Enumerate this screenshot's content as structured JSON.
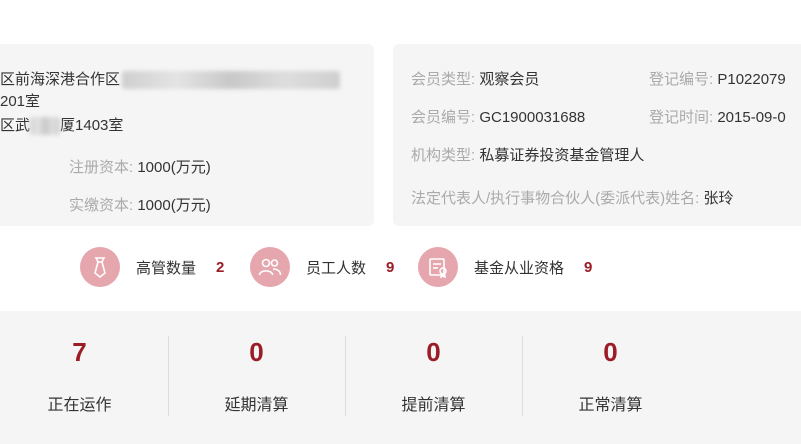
{
  "left_card": {
    "address_line1": "区前海深港合作区",
    "address_line2": "201室",
    "address_line3_prefix": "区武",
    "address_line3_suffix": "厦1403室",
    "registered_capital_label": "注册资本:",
    "registered_capital_value": "1000(万元)",
    "paid_capital_label": "实缴资本:",
    "paid_capital_value": "1000(万元)"
  },
  "right_card": {
    "member_type_label": "会员类型:",
    "member_type_value": "观察会员",
    "reg_no_label": "登记编号:",
    "reg_no_value": "P1022079",
    "member_no_label": "会员编号:",
    "member_no_value": "GC1900031688",
    "reg_time_label": "登记时间:",
    "reg_time_value": "2015-09-0",
    "org_type_label": "机构类型:",
    "org_type_value": "私募证券投资基金管理人",
    "legal_rep_label": "法定代表人/执行事物合伙人(委派代表)姓名:",
    "legal_rep_value": "张玲"
  },
  "stats": [
    {
      "icon": "tie-icon",
      "label": "高管数量",
      "value": "2"
    },
    {
      "icon": "people-icon",
      "label": "员工人数",
      "value": "9"
    },
    {
      "icon": "certificate-icon",
      "label": "基金从业资格",
      "value": "9"
    }
  ],
  "fund_status": [
    {
      "value": "7",
      "label": "正在运作"
    },
    {
      "value": "0",
      "label": "延期清算"
    },
    {
      "value": "0",
      "label": "提前清算"
    },
    {
      "value": "0",
      "label": "正常清算"
    }
  ],
  "colors": {
    "accent": "#9b1c24",
    "icon_bg": "#e5a6ad",
    "card_bg": "#f5f5f5"
  }
}
